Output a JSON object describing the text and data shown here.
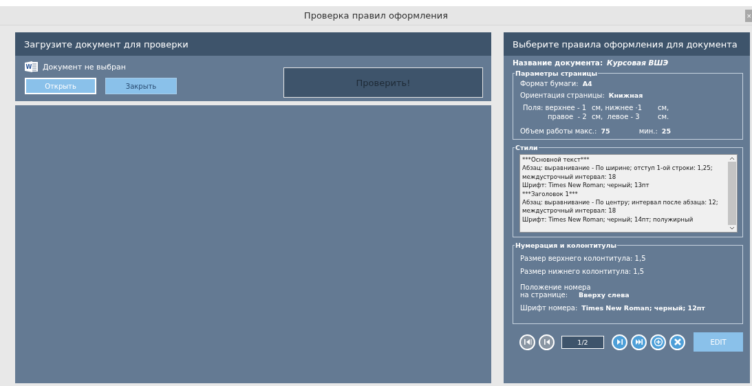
{
  "window": {
    "title": "Проверка правил оформления",
    "close": "×"
  },
  "upload": {
    "header": "Загрузите документ для проверки",
    "status": "Документ не выбран",
    "status_icon_letter": "W",
    "buttons": [
      {
        "label": "Открыть",
        "focused": true
      },
      {
        "label": "Закрыть",
        "focused": false
      }
    ],
    "check_button": "Проверить!"
  },
  "rules": {
    "header": "Выберите правила оформления для документа",
    "doc_name_label": "Название документа:",
    "doc_name": "Курсовая ВШЭ",
    "page_params": {
      "title": "Параметры страницы",
      "paper_label": "Формат бумаги:",
      "paper": "A4",
      "orientation_label": "Ориентация страницы:",
      "orientation": "Книжная",
      "margins": [
        [
          "Поля: верхнее - 1",
          "см, нижнее ·1",
          "см,"
        ],
        [
          "правое  - 2",
          "см,  левое - 3",
          "см."
        ]
      ],
      "volume_max_label": "Объем работы макс.:",
      "volume_max": "75",
      "volume_min_label": "мин.:",
      "volume_min": "25"
    },
    "styles": {
      "title": "Стили",
      "lines": [
        "***Основной текст***",
        "Абзац: выравнивание - По ширине; отступ 1-ой строки: 1,25; междустрочный интервал: 18",
        "Шрифт: Times New Roman; черный; 13пт",
        "***Заголовок 1***",
        "Абзац: выравнивание - По центру; интервал после абзаца: 12; междустрочный интервал: 18",
        "Шрифт: Times New Roman; черный; 14пт; полужирный"
      ]
    },
    "numbering": {
      "title": "Нумерация и колонтитулы",
      "header_size": "Размер верхнего колонтитула: 1,5",
      "footer_size": "Размер нижнего колонтитула: 1,5",
      "position_label_1": "Положение номера",
      "position_label_2": "на странице:",
      "position": "Вверху слева",
      "font_label": "Шрифт номера:",
      "font": "Times New Roman; черный; 12пт"
    },
    "nav": {
      "buttons": [
        {
          "kind": "first",
          "disabled": true
        },
        {
          "kind": "prev",
          "disabled": true
        }
      ],
      "page": "1/2",
      "buttons2": [
        {
          "kind": "next",
          "disabled": false
        },
        {
          "kind": "last",
          "disabled": false
        },
        {
          "kind": "add",
          "disabled": false
        },
        {
          "kind": "delete",
          "disabled": false
        }
      ],
      "edit": {
        "label": "EDIT",
        "disabled": true
      }
    }
  }
}
